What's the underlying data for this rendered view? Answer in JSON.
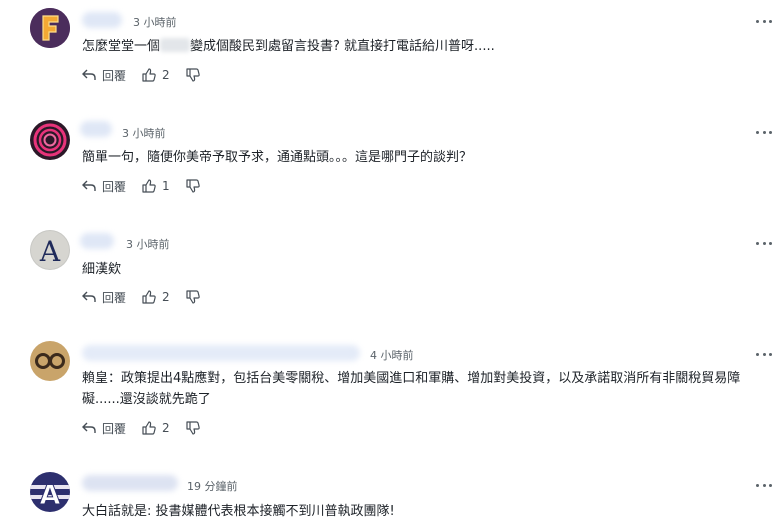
{
  "comments": [
    {
      "time": "3 小時前",
      "text_before": "怎麼堂堂一個",
      "text_after": "變成個酸民到處留言投書? 就直接打電話給川普呀.....",
      "reply_label": "回覆",
      "likes": "2",
      "avatar": "letter-F",
      "colors": {
        "avatar_bg": "#4b2d5c",
        "letter": "#f4a934"
      }
    },
    {
      "time": "3 小時前",
      "text": "簡單一句，隨便你美帝予取予求，通通點頭。。。這是哪門子的談判？",
      "reply_label": "回覆",
      "likes": "1",
      "avatar": "pink-rings",
      "colors": {
        "avatar_bg": "#2b1828",
        "ring": "#e8337a"
      }
    },
    {
      "time": "3 小時前",
      "text": "細漢欸",
      "reply_label": "回覆",
      "likes": "2",
      "avatar": "letter-A-grey",
      "colors": {
        "avatar_bg": "#c8c8c4",
        "letter": "#1f2a5a"
      }
    },
    {
      "time": "4 小時前",
      "text": "賴皇：政策提出4點應對，包括台美零關稅、增加美國進口和軍購、增加對美投資，以及承諾取消所有非關稅貿易障礙......還沒談就先跪了",
      "reply_label": "回覆",
      "likes": "2",
      "avatar": "owl-eyes",
      "colors": {
        "avatar_bg": "#c9a46a",
        "eye": "#3b2a1c"
      }
    },
    {
      "time": "19 分鐘前",
      "text": "大白話就是: 投書媒體代表根本接觸不到川普執政團隊!",
      "avatar": "letter-A-striped",
      "colors": {
        "avatar_bg": "#2d2f6e",
        "letter": "#ffffff"
      }
    }
  ]
}
